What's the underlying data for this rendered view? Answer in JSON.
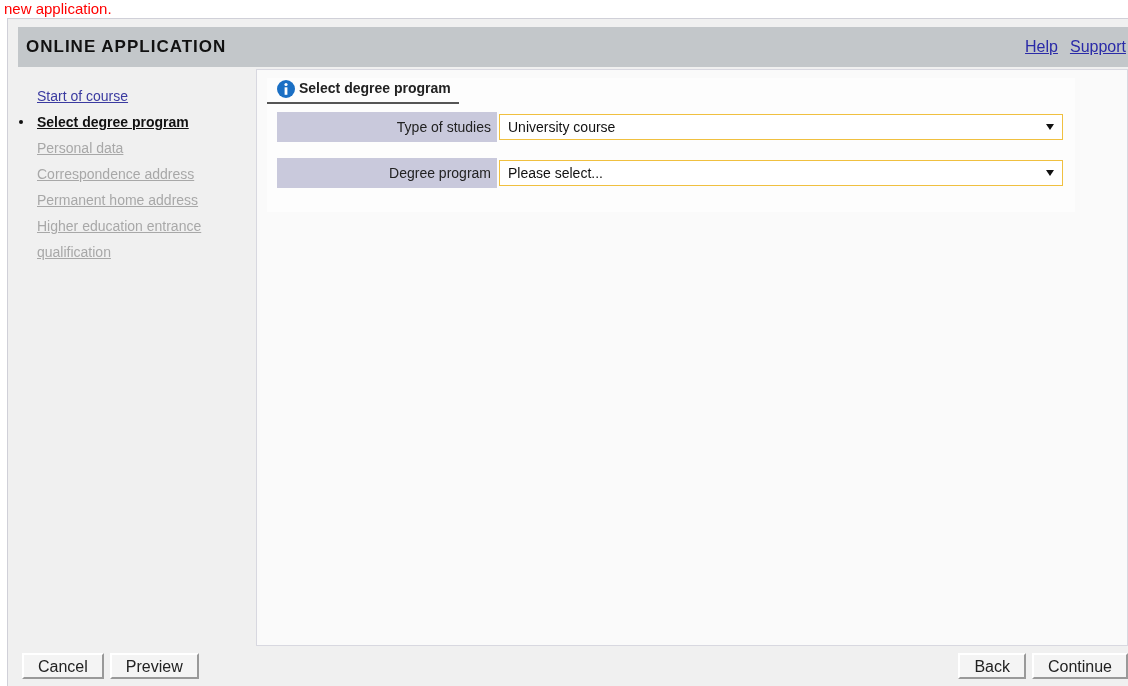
{
  "caption": "new application.",
  "header": {
    "title": "ONLINE APPLICATION",
    "links": [
      "Help",
      "Support"
    ]
  },
  "steps": [
    {
      "label": "Start of course",
      "selected": false,
      "disabled": false
    },
    {
      "label": "Select degree program",
      "selected": true,
      "disabled": false
    },
    {
      "label": "Personal data",
      "selected": false,
      "disabled": true
    },
    {
      "label": "Correspondence address",
      "selected": false,
      "disabled": true
    },
    {
      "label": "Permanent home address",
      "selected": false,
      "disabled": true
    },
    {
      "label": "Higher education entrance qualification",
      "selected": false,
      "disabled": true
    }
  ],
  "section": {
    "title": "Select degree program",
    "fields": [
      {
        "label": "Type of studies",
        "value": "University course"
      },
      {
        "label": "Degree program",
        "value": "Please select..."
      }
    ]
  },
  "left_buttons": [
    "Cancel",
    "Preview"
  ],
  "right_buttons": [
    "Back",
    "Continue"
  ]
}
